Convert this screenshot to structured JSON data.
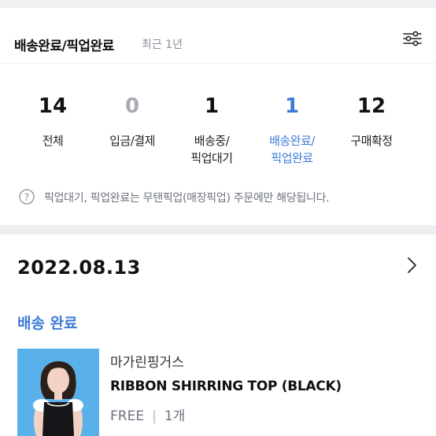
{
  "header": {
    "title": "배송완료/픽업완료",
    "period": "최근 1년",
    "filter_icon": "sliders-icon"
  },
  "stats": [
    {
      "count": "14",
      "label": "전체"
    },
    {
      "count": "0",
      "label": "입금/결제"
    },
    {
      "count": "1",
      "label_line1": "배송중/",
      "label_line2": "픽업대기"
    },
    {
      "count": "1",
      "label_line1": "배송완료/",
      "label_line2": "픽업완료"
    },
    {
      "count": "12",
      "label": "구매확정"
    }
  ],
  "notice": {
    "icon": "question-circle-icon",
    "text": "픽업대기, 픽업완료는 무탠픽업(매장픽업) 주문에만 해당됩니다."
  },
  "order": {
    "date": "2022.08.13",
    "status": "배송 완료",
    "brand": "마가린핑거스",
    "product_name": "RIBBON SHIRRING TOP (BLACK)",
    "option_size": "FREE",
    "option_qty": "1개"
  },
  "colors": {
    "accent": "#3e7bd6",
    "muted": "#a9acb2",
    "background": "#eeeff1",
    "thumb_bg": "#5ab1ea"
  }
}
